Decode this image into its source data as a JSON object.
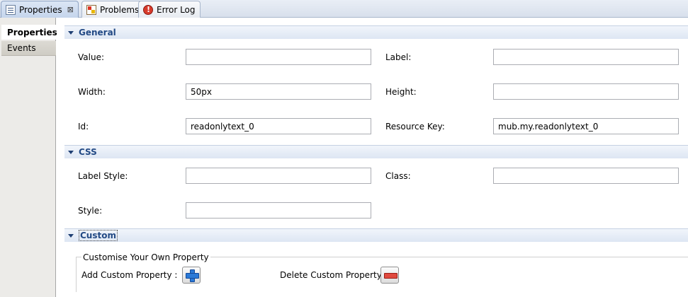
{
  "tabs": [
    {
      "label": "Properties",
      "icon": "properties-icon",
      "active": true,
      "close": "⊠"
    },
    {
      "label": "Problems",
      "icon": "problems-icon",
      "active": false
    },
    {
      "label": "Error Log",
      "icon": "error-log-icon",
      "active": false
    }
  ],
  "sidebar": {
    "items": [
      {
        "label": "Properties",
        "selected": true
      },
      {
        "label": "Events",
        "selected": false
      }
    ]
  },
  "general": {
    "title": "General",
    "value_label": "Value:",
    "value": "",
    "label_label": "Label:",
    "label_value": "",
    "width_label": "Width:",
    "width_value": "50px",
    "height_label": "Height:",
    "height_value": "",
    "id_label": "Id:",
    "id_value": "readonlytext_0",
    "resource_key_label": "Resource Key:",
    "resource_key_value": "mub.my.readonlytext_0"
  },
  "css": {
    "title": "CSS",
    "label_style_label": "Label Style:",
    "label_style_value": "",
    "class_label": "Class:",
    "class_value": "",
    "style_label": "Style:",
    "style_value": ""
  },
  "custom": {
    "title": "Custom",
    "group_title": "Customise Your Own Property",
    "add_label": "Add Custom Property :",
    "delete_label": "Delete Custom Property :"
  },
  "colors": {
    "section_title": "#234a85",
    "add_icon": "#2b79d6",
    "delete_icon": "#e04a3f"
  }
}
